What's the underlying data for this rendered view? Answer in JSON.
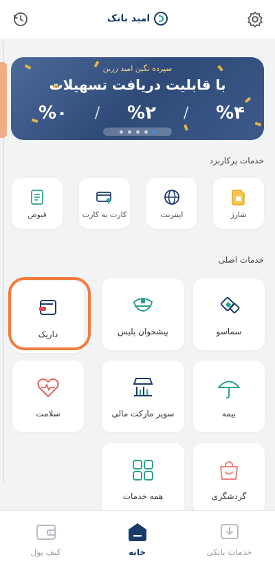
{
  "header": {
    "app_name": "امید بانک",
    "history_icon": "history-icon",
    "settings_icon": "gear-icon"
  },
  "banner": {
    "subtitle": "سپرده نگین امید زرین",
    "title": "با قابلیت دریافت تسهیلات",
    "rates": [
      "%۴",
      "%۲",
      "%۰"
    ],
    "slides": 5,
    "active_slide": 5,
    "accent": "#e2b24a"
  },
  "quick_services": {
    "title": "خدمات پرکاربرد",
    "items": [
      {
        "label": "شارژ",
        "icon": "sim-card-icon"
      },
      {
        "label": "اینترنت",
        "icon": "globe-icon"
      },
      {
        "label": "کارت به کارت",
        "icon": "card-transfer-icon"
      },
      {
        "label": "قبوض",
        "icon": "bill-icon"
      }
    ]
  },
  "main_services": {
    "title": "خدمات اصلی",
    "items": [
      {
        "label": "سماسو",
        "icon": "samaso-icon"
      },
      {
        "label": "پیشخوان پلیس",
        "icon": "police-cap-icon"
      },
      {
        "label": "داریک",
        "icon": "wallet-icon"
      },
      {
        "label": "بیمه",
        "icon": "umbrella-icon"
      },
      {
        "label": "سوپر مارکت مالی",
        "icon": "market-icon"
      },
      {
        "label": "سلامت",
        "icon": "heart-pulse-icon"
      },
      {
        "label": "گردشگری",
        "icon": "bag-icon"
      },
      {
        "label": "همه خدمات",
        "icon": "grid-icon"
      }
    ]
  },
  "bottom_nav": {
    "items": [
      {
        "label": "خدمات بانکی",
        "icon": "banking-services-icon",
        "active": false
      },
      {
        "label": "خانه",
        "icon": "home-icon",
        "active": true
      },
      {
        "label": "کیف پول",
        "icon": "wallet-nav-icon",
        "active": false
      }
    ]
  },
  "colors": {
    "accent_orange": "#f47b3c",
    "brand_navy": "#1a3a6b",
    "teal": "#2aa18f"
  }
}
